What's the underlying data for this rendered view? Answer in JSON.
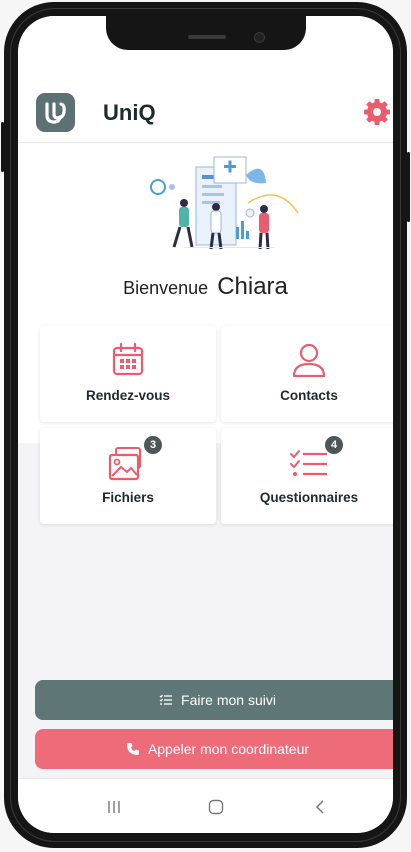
{
  "app": {
    "title": "UniQ",
    "logo_letter": "U"
  },
  "header": {
    "settings_icon": "gear-icon"
  },
  "welcome": {
    "greeting": "Bienvenue",
    "user_name": "Chiara"
  },
  "tiles": [
    {
      "label": "Rendez-vous",
      "icon": "calendar-icon"
    },
    {
      "label": "Contacts",
      "icon": "user-icon"
    },
    {
      "label": "Fichiers",
      "icon": "files-icon",
      "badge": "3"
    },
    {
      "label": "Questionnaires",
      "icon": "checklist-icon",
      "badge": "4"
    }
  ],
  "actions": {
    "follow_label": "Faire mon suivi",
    "call_label": "Appeler mon coordinateur"
  },
  "colors": {
    "accent": "#e95d6e",
    "primary": "#5e7675",
    "call": "#ee6b79",
    "badge": "#4c5758"
  },
  "navbar": {
    "recent_icon": "recent-apps-icon",
    "home_icon": "home-icon",
    "back_icon": "back-icon"
  }
}
